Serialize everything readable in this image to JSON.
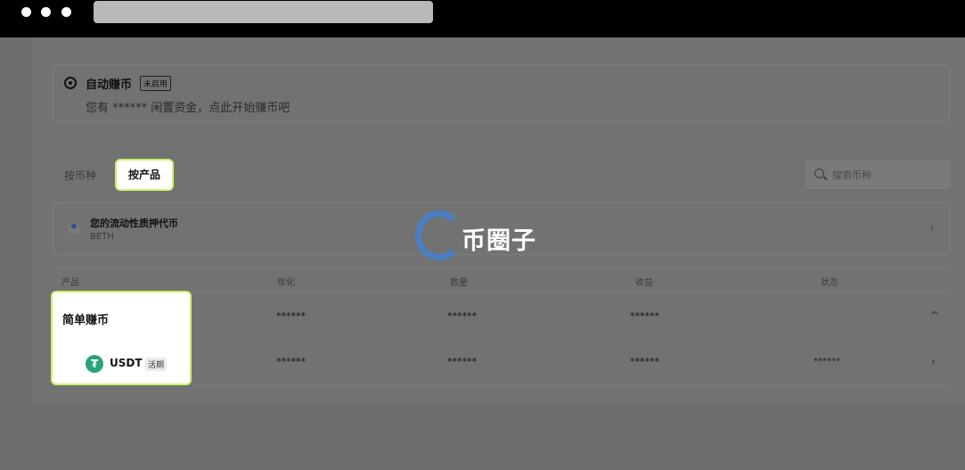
{
  "auto_earn": {
    "title": "自动赚币",
    "badge": "未启用",
    "subtitle": "您有 ****** 闲置资金，点此开始赚币吧"
  },
  "tabs": [
    {
      "label": "按币种"
    },
    {
      "label": "按产品"
    }
  ],
  "search": {
    "placeholder": "搜索币种"
  },
  "beth": {
    "title": "您的流动性质押代币",
    "subtitle": "BETH",
    "chevron": "›"
  },
  "watermark": {
    "text": "币圈子"
  },
  "table": {
    "headers": [
      "产品",
      "年化",
      "数量",
      "收益",
      "状态"
    ],
    "group": {
      "name": "简单赚币",
      "apr": "******",
      "amount": "******",
      "earn": "******",
      "chevron": "^"
    },
    "row": {
      "coin": "USDT",
      "coin_icon": "₮",
      "type": "活期",
      "apr": "******",
      "amount": "******",
      "earn": "******",
      "status": "******",
      "chevron": "›"
    }
  },
  "colors": {
    "accent_border": "#c9f26b",
    "usdt_green": "#2aa37a"
  }
}
